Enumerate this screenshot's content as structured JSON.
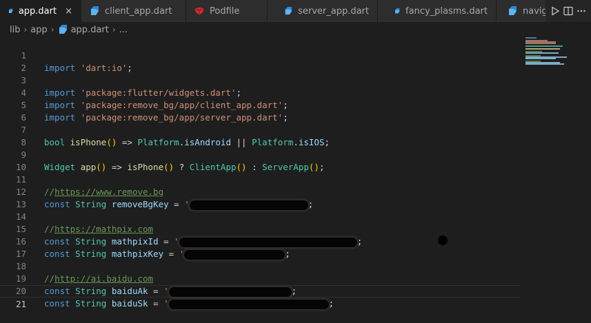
{
  "tabs": [
    {
      "label": "app.dart",
      "icon": "dart-icon",
      "active": true
    },
    {
      "label": "client_app.dart",
      "icon": "dart-icon",
      "active": false
    },
    {
      "label": "Podfile",
      "icon": "ruby-icon",
      "active": false
    },
    {
      "label": "server_app.dart",
      "icon": "dart-icon",
      "active": false
    },
    {
      "label": "fancy_plasms.dart",
      "icon": "dart-icon",
      "active": false
    },
    {
      "label": "navig",
      "icon": "dart-icon",
      "active": false
    }
  ],
  "close_glyph": "×",
  "breadcrumb": {
    "items": [
      "lib",
      "app",
      "app.dart",
      "..."
    ]
  },
  "colors": {
    "keyword": "#569cd6",
    "string": "#ce9178",
    "type": "#4ec9b0",
    "function": "#dcdcaa",
    "variable": "#9cdcfe",
    "comment": "#6a9955"
  },
  "code": {
    "l1": {
      "n": "1",
      "kw": "import",
      "str": "'dart:io'",
      "end": ";"
    },
    "l2": {
      "n": "2"
    },
    "l3": {
      "n": "3",
      "kw": "import",
      "str": "'package:flutter/widgets.dart'",
      "end": ";"
    },
    "l4": {
      "n": "4",
      "kw": "import",
      "str": "'package:remove_bg/app/client_app.dart'",
      "end": ";"
    },
    "l5": {
      "n": "5",
      "kw": "import",
      "str": "'package:remove_bg/app/server_app.dart'",
      "end": ";"
    },
    "l6": {
      "n": "6"
    },
    "l7": {
      "n": "7",
      "t1": "bool",
      "f1": "isPhone",
      "p1": "()",
      "arrow": " => ",
      "c1": "Platform",
      "dot1": ".",
      "v1": "isAndroid",
      "or": " || ",
      "c2": "Platform",
      "dot2": ".",
      "v2": "isIOS",
      "end": ";"
    },
    "l8": {
      "n": "8"
    },
    "l9": {
      "n": "9",
      "t1": "Widget",
      "f1": "app",
      "p1": "()",
      "arrow": " => ",
      "f2": "isPhone",
      "p2": "()",
      "q": " ? ",
      "c1": "ClientApp",
      "p3": "()",
      "colon": " : ",
      "c2": "ServerApp",
      "p4": "()",
      "end": ";"
    },
    "l10": {
      "n": "10"
    },
    "l11": {
      "n": "11",
      "cm": "//",
      "url": "https://www.remove.bg"
    },
    "l12": {
      "n": "12",
      "kw": "const",
      "typ": "String",
      "var": "removeBgKey",
      "eq": " = ",
      "q1": "'",
      "end": ";"
    },
    "l13": {
      "n": "13"
    },
    "l14": {
      "n": "14",
      "cm": "//",
      "url": "https://mathpix.com"
    },
    "l15": {
      "n": "15",
      "kw": "const",
      "typ": "String",
      "var": "mathpixId",
      "eq": " = ",
      "q1": "'",
      "end": ";"
    },
    "l16": {
      "n": "16",
      "kw": "const",
      "typ": "String",
      "var": "mathpixKey",
      "eq": " = ",
      "q1": "'",
      "end": ";"
    },
    "l17": {
      "n": "17"
    },
    "l18": {
      "n": "18",
      "cm": "//",
      "url": "http://ai.baidu.com"
    },
    "l19": {
      "n": "19",
      "kw": "const",
      "typ": "String",
      "var": "baiduAk",
      "eq": " = ",
      "q1": "'",
      "end": ";"
    },
    "l20": {
      "n": "20",
      "kw": "const",
      "typ": "String",
      "var": "baiduSk",
      "eq": " = ",
      "q1": "'",
      "end": ";"
    },
    "l21": {
      "n": "21"
    }
  }
}
